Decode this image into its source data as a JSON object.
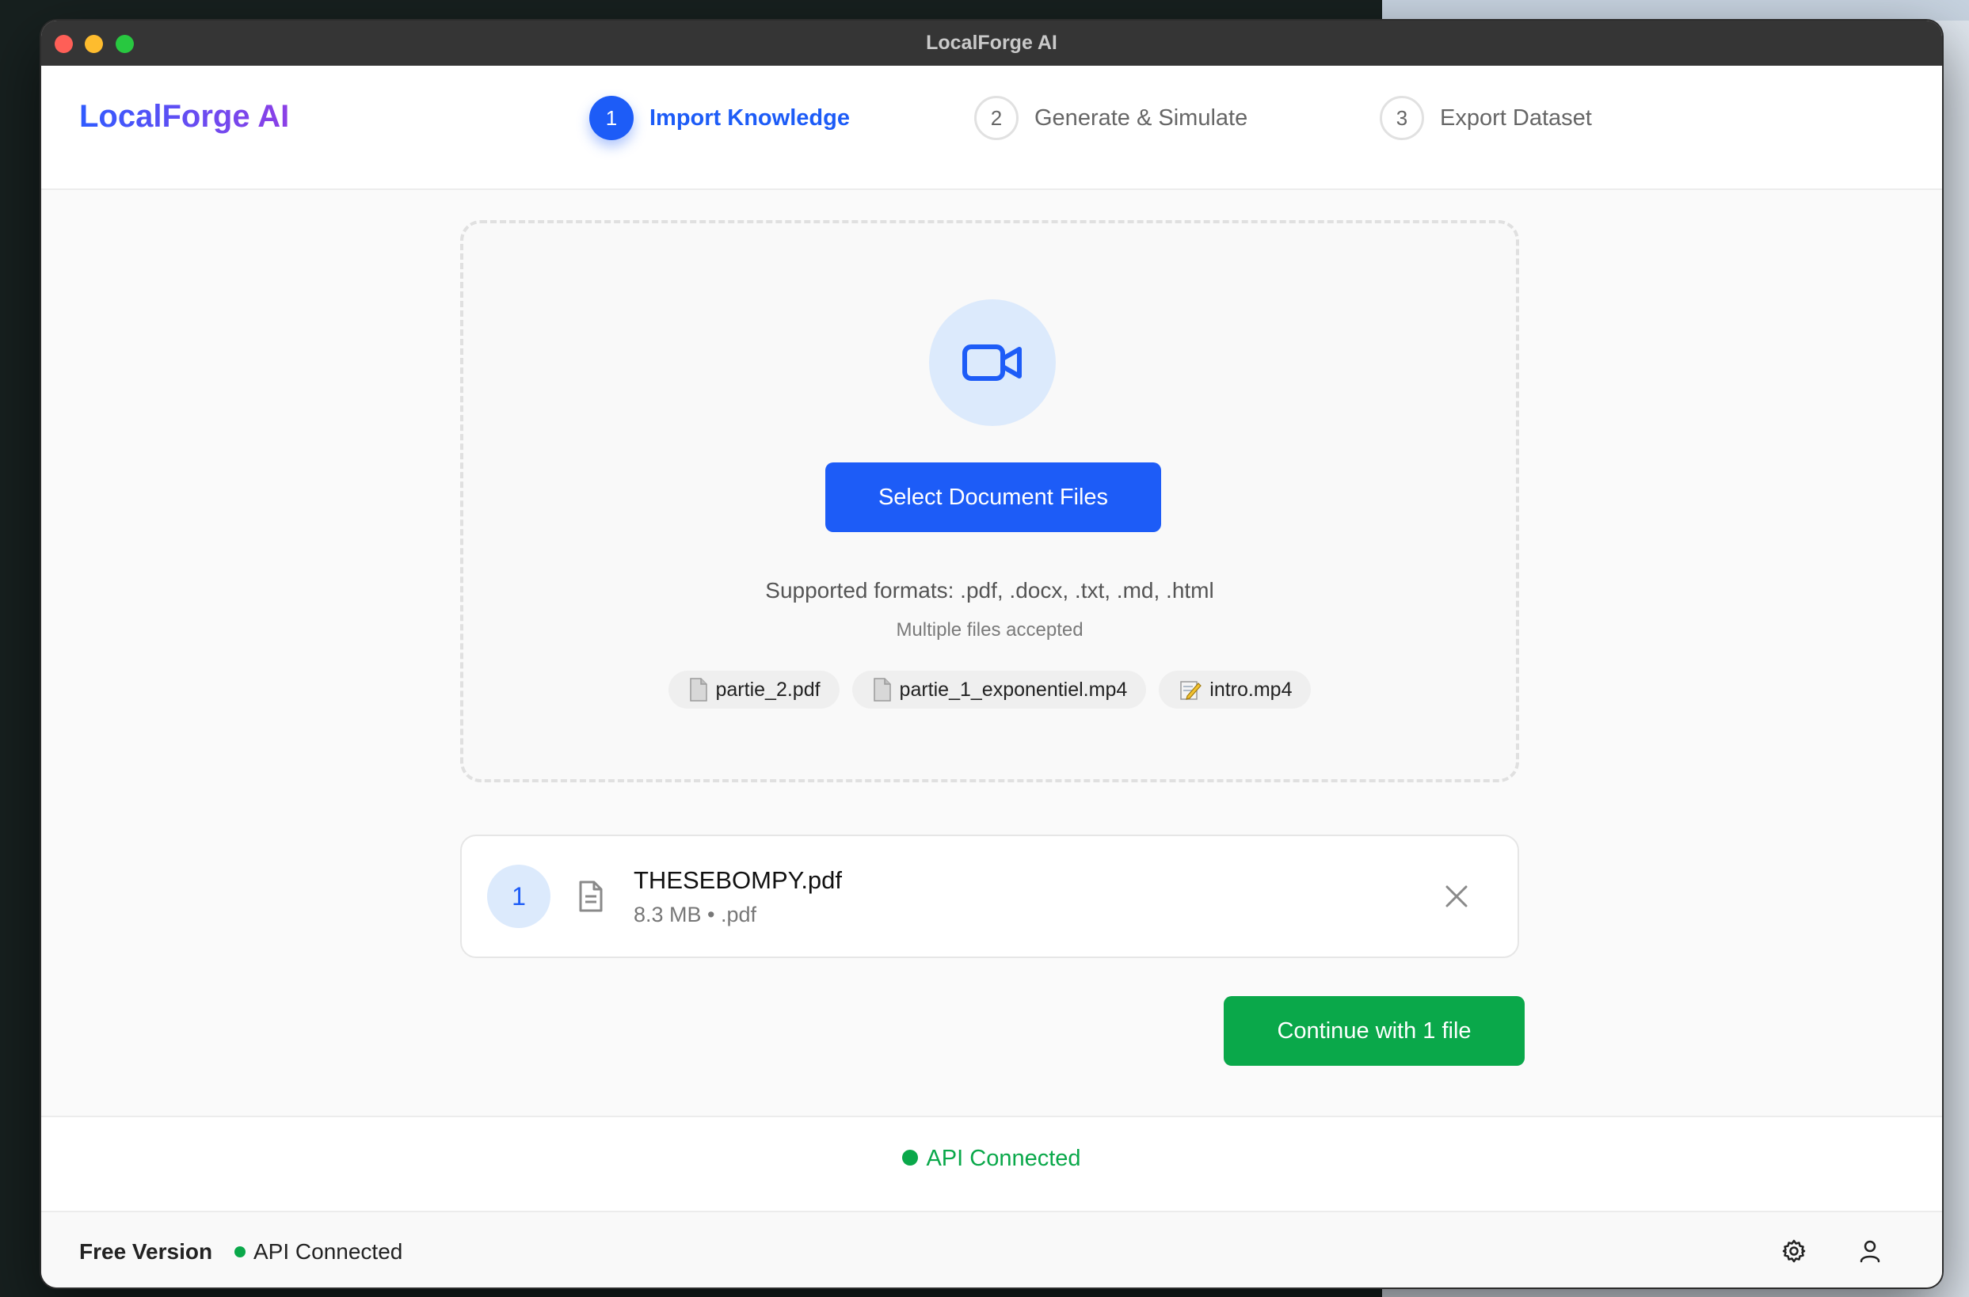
{
  "window": {
    "title": "LocalForge AI"
  },
  "header": {
    "logo": "LocalForge AI",
    "steps": [
      {
        "number": "1",
        "label": "Import Knowledge",
        "state": "active"
      },
      {
        "number": "2",
        "label": "Generate & Simulate",
        "state": "idle"
      },
      {
        "number": "3",
        "label": "Export Dataset",
        "state": "idle"
      }
    ]
  },
  "dropzone": {
    "icon": "video-camera-icon",
    "select_label": "Select Document Files",
    "formats": "Supported formats: .pdf, .docx, .txt, .md, .html",
    "multiple": "Multiple files accepted",
    "recent": [
      {
        "name": "partie_2.pdf",
        "icon": "document-page-icon"
      },
      {
        "name": "partie_1_exponentiel.mp4",
        "icon": "document-page-icon"
      },
      {
        "name": "intro.mp4",
        "icon": "memo-icon"
      }
    ]
  },
  "file_list": [
    {
      "index": "1",
      "name": "THESEBOMPY.pdf",
      "meta": "8.3 MB • .pdf"
    }
  ],
  "actions": {
    "continue_label": "Continue with 1 file"
  },
  "status": {
    "api": "API Connected"
  },
  "footer": {
    "version": "Free Version",
    "api": "API Connected"
  },
  "colors": {
    "accent": "#1d5cf7",
    "success": "#0aa84a",
    "logo_start": "#2f5bff",
    "logo_end": "#8c3fe6"
  }
}
